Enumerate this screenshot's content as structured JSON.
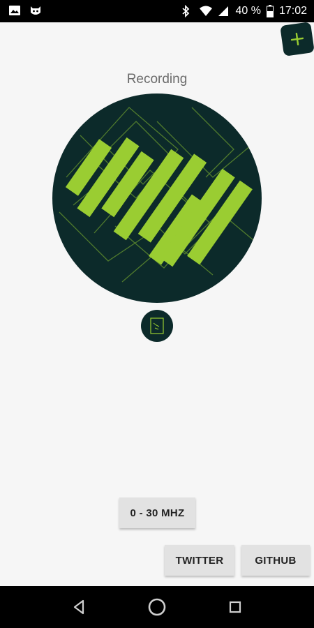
{
  "status_bar": {
    "battery_percent": "40 %",
    "time": "17:02",
    "icons": [
      "image-icon",
      "cat-icon",
      "bluetooth-icon",
      "wifi-icon",
      "signal-icon",
      "battery-icon"
    ]
  },
  "header": {
    "add_button_icon": "plus-icon"
  },
  "main": {
    "status_label": "Recording",
    "logo_icon": "app-logo-icon",
    "secondary_icon": "spectrum-file-icon"
  },
  "buttons": {
    "frequency_label": "0 - 30 MHZ",
    "twitter_label": "TWITTER",
    "github_label": "GITHUB"
  },
  "nav": {
    "icons": [
      "back-icon",
      "home-icon",
      "recents-icon"
    ]
  },
  "colors": {
    "accent": "#9ACD32",
    "dark": "#0C2A2A",
    "background": "#F6F6F6"
  }
}
